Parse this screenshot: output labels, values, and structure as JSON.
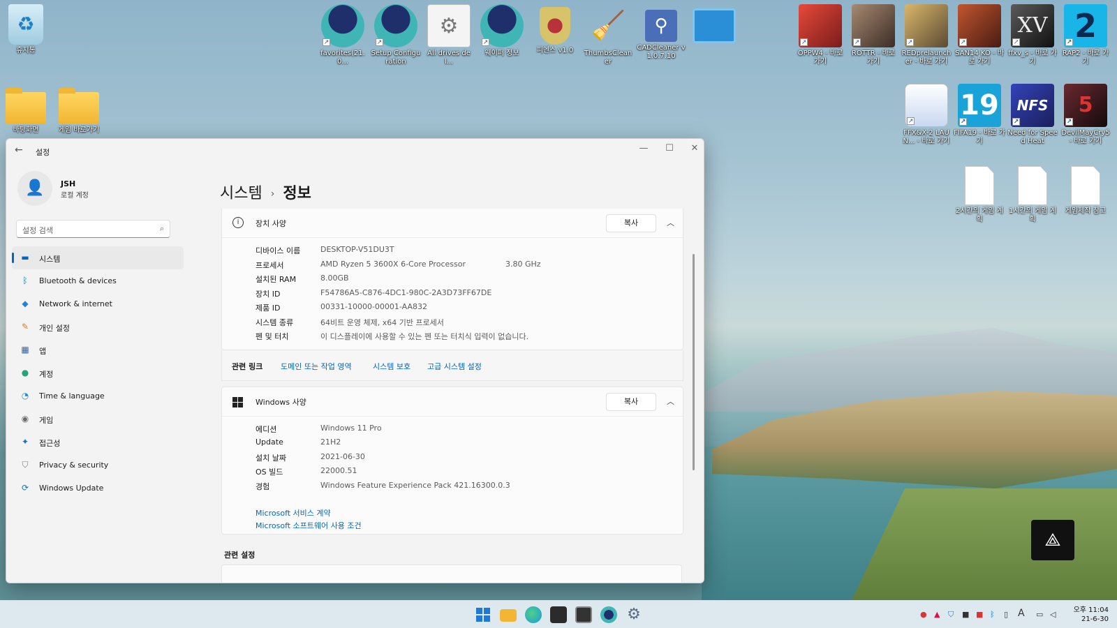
{
  "desktop": {
    "top_icons": [
      {
        "label": "favorites(21.0...",
        "color": "#3fb6b5"
      },
      {
        "label": "Setup Configuration",
        "color": "#3fb6b5"
      },
      {
        "label": "All drives del...",
        "color": "#e8e8e8"
      },
      {
        "label": "웨이퍼 정보",
        "color": "#3fb6b5"
      },
      {
        "label": "피멘스 v1.0",
        "color": "#d6c36a"
      },
      {
        "label": "ThumbsCleaner",
        "color": "#f0b54a"
      },
      {
        "label": "CADCleaner v1.0.7.10",
        "color": "#4a6fb8"
      },
      {
        "label": "",
        "color": "#2a8fd6"
      }
    ],
    "left_icons": [
      {
        "label": "휴지통"
      },
      {
        "label": "바탕화면"
      },
      {
        "label": "게임 바로가기"
      }
    ],
    "right_icons_row1": [
      {
        "label": "OPPW4 - 바로 가기",
        "color": "#c2342d"
      },
      {
        "label": "ROTTR - 바로 가기",
        "color": "#7a5a4a"
      },
      {
        "label": "REDprelauncher - 바로 가기",
        "color": "#c9a75a"
      },
      {
        "label": "SAN14 KO - 바로 가기",
        "color": "#9c3d2c"
      },
      {
        "label": "ffxv_s - 바로 가기",
        "color": "#2b2b2b"
      },
      {
        "label": "RAP2 - 바로 가기",
        "color": "#17b5e8"
      }
    ],
    "right_icons_row2": [
      {
        "label": "FFX&X-2 LAUN... - 바로 가기",
        "color": "#dde6f5"
      },
      {
        "label": "FIFA19 - 바로 가기",
        "color": "#19a3d8"
      },
      {
        "label": "Need for Speed Heat",
        "color": "#2d3b9c"
      },
      {
        "label": "DevilMayCry5 - 바로 가기",
        "color": "#3a1e22"
      }
    ],
    "right_icons_row3": [
      {
        "label": "2시간의 게임 계획"
      },
      {
        "label": "1시간의 게임 계획"
      },
      {
        "label": "게임제작 참고"
      }
    ]
  },
  "window": {
    "title": "설정",
    "back_icon": "back-arrow-icon",
    "controls": {
      "minimize": "—",
      "maximize": "☐",
      "close": "✕"
    }
  },
  "profile": {
    "name": "JSH",
    "account_type": "로컬 계정"
  },
  "search": {
    "placeholder": "설정 검색"
  },
  "nav": [
    {
      "label": "시스템",
      "icon": "monitor-icon",
      "color": "#0067c0",
      "active": true
    },
    {
      "label": "Bluetooth & devices",
      "icon": "bluetooth-icon",
      "color": "#0078d4"
    },
    {
      "label": "Network & internet",
      "icon": "wifi-icon",
      "color": "#2d7fd6"
    },
    {
      "label": "개인 설정",
      "icon": "brush-icon",
      "color": "#e07a22"
    },
    {
      "label": "앱",
      "icon": "apps-icon",
      "color": "#3a5fa0"
    },
    {
      "label": "계정",
      "icon": "person-icon",
      "color": "#2aa37a"
    },
    {
      "label": "Time & language",
      "icon": "globe-clock-icon",
      "color": "#2a8bd6"
    },
    {
      "label": "게임",
      "icon": "gamepad-icon",
      "color": "#6a6a6a"
    },
    {
      "label": "접근성",
      "icon": "accessibility-icon",
      "color": "#1b6fc2"
    },
    {
      "label": "Privacy & security",
      "icon": "shield-icon",
      "color": "#7a7a7a"
    },
    {
      "label": "Windows Update",
      "icon": "update-icon",
      "color": "#0078d4"
    }
  ],
  "breadcrumb": {
    "parent": "시스템",
    "separator": "›",
    "current": "정보"
  },
  "device_specs": {
    "title": "장치 사양",
    "copy_label": "복사",
    "rows": [
      {
        "key": "디바이스 이름",
        "value": "DESKTOP-V51DU3T",
        "extra": ""
      },
      {
        "key": "프로세서",
        "value": "AMD Ryzen 5 3600X 6-Core Processor",
        "extra": "3.80 GHz"
      },
      {
        "key": "설치된 RAM",
        "value": "8.00GB",
        "extra": ""
      },
      {
        "key": "장치 ID",
        "value": "F54786A5-C876-4DC1-980C-2A3D73FF67DE",
        "extra": ""
      },
      {
        "key": "제품 ID",
        "value": "00331-10000-00001-AA832",
        "extra": ""
      },
      {
        "key": "시스템 종류",
        "value": "64비트 운영 체제, x64 기반 프로세서",
        "extra": ""
      },
      {
        "key": "펜 및 터치",
        "value": "이 디스플레이에 사용할 수 있는 펜 또는 터치식 입력이 없습니다.",
        "extra": ""
      }
    ]
  },
  "related_links": {
    "label": "관련 링크",
    "links": [
      "도메인 또는 작업 영역",
      "시스템 보호",
      "고급 시스템 설정"
    ]
  },
  "windows_specs": {
    "title": "Windows 사양",
    "copy_label": "복사",
    "rows": [
      {
        "key": "에디션",
        "value": "Windows 11 Pro"
      },
      {
        "key": "Update",
        "value": "21H2"
      },
      {
        "key": "설치 날짜",
        "value": "2021-06-30"
      },
      {
        "key": "OS 빌드",
        "value": "22000.51"
      },
      {
        "key": "경험",
        "value": "Windows Feature Experience Pack 421.16300.0.3"
      }
    ],
    "links": [
      "Microsoft 서비스 계약",
      "Microsoft 소프트웨어 사용 조건"
    ]
  },
  "related_settings": {
    "title": "관련 설정"
  },
  "taskbar": {
    "icons": [
      {
        "name": "start-icon",
        "color": "#1e7ad6"
      },
      {
        "name": "file-explorer-icon",
        "color": "#f2b632"
      },
      {
        "name": "edge-icon",
        "color": "#1a9bd8"
      },
      {
        "name": "store-icon",
        "color": "#2b2b2b"
      },
      {
        "name": "terminal-icon",
        "color": "#333333"
      },
      {
        "name": "app-icon",
        "color": "#3fb6b5"
      },
      {
        "name": "settings-gear-icon",
        "color": "#5b6c80"
      }
    ],
    "tray_ime": "A",
    "clock_time": "오후 11:04",
    "clock_date": "21-6-30"
  }
}
